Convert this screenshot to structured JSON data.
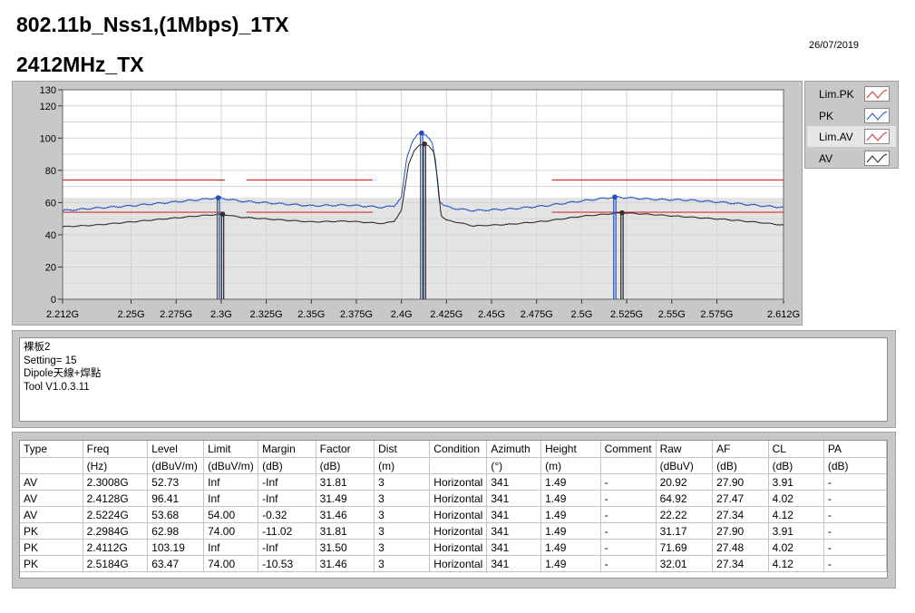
{
  "header": {
    "title_line1": "802.11b_Nss1,(1Mbps)_1TX",
    "title_line2": "2412MHz_TX",
    "date": "26/07/2019"
  },
  "legend": {
    "items": [
      {
        "label": "Lim.PK",
        "color": "#d0302f"
      },
      {
        "label": "PK",
        "color": "#1f4fbf"
      },
      {
        "label": "Lim.AV",
        "color": "#d0302f"
      },
      {
        "label": "AV",
        "color": "#222222"
      }
    ]
  },
  "notes": {
    "lines": [
      "裸板2",
      "Setting= 15",
      "Dipole天線+焊點",
      "Tool V1.0.3.11"
    ]
  },
  "table": {
    "columns": [
      "Type",
      "Freq",
      "Level",
      "Limit",
      "Margin",
      "Factor",
      "Dist",
      "Condition",
      "Azimuth",
      "Height",
      "Comment",
      "Raw",
      "AF",
      "CL",
      "PA"
    ],
    "units": [
      "",
      "(Hz)",
      "(dBuV/m)",
      "(dBuV/m)",
      "(dB)",
      "(dB)",
      "(m)",
      "",
      "(°)",
      "(m)",
      "",
      "(dBuV)",
      "(dB)",
      "(dB)",
      "(dB)"
    ],
    "rows": [
      [
        "AV",
        "2.3008G",
        "52.73",
        "Inf",
        "-Inf",
        "31.81",
        "3",
        "Horizontal",
        "341",
        "1.49",
        "-",
        "20.92",
        "27.90",
        "3.91",
        "-"
      ],
      [
        "AV",
        "2.4128G",
        "96.41",
        "Inf",
        "-Inf",
        "31.49",
        "3",
        "Horizontal",
        "341",
        "1.49",
        "-",
        "64.92",
        "27.47",
        "4.02",
        "-"
      ],
      [
        "AV",
        "2.5224G",
        "53.68",
        "54.00",
        "-0.32",
        "31.46",
        "3",
        "Horizontal",
        "341",
        "1.49",
        "-",
        "22.22",
        "27.34",
        "4.12",
        "-"
      ],
      [
        "PK",
        "2.2984G",
        "62.98",
        "74.00",
        "-11.02",
        "31.81",
        "3",
        "Horizontal",
        "341",
        "1.49",
        "-",
        "31.17",
        "27.90",
        "3.91",
        "-"
      ],
      [
        "PK",
        "2.4112G",
        "103.19",
        "Inf",
        "-Inf",
        "31.50",
        "3",
        "Horizontal",
        "341",
        "1.49",
        "-",
        "71.69",
        "27.48",
        "4.02",
        "-"
      ],
      [
        "PK",
        "2.5184G",
        "63.47",
        "74.00",
        "-10.53",
        "31.46",
        "3",
        "Horizontal",
        "341",
        "1.49",
        "-",
        "32.01",
        "27.34",
        "4.12",
        "-"
      ]
    ]
  },
  "chart_data": {
    "type": "line",
    "title": "",
    "xlabel": "",
    "ylabel": "",
    "xlim": [
      2.212,
      2.612
    ],
    "ylim": [
      0,
      130
    ],
    "x_ticks": [
      "2.212G",
      "2.25G",
      "2.275G",
      "2.3G",
      "2.325G",
      "2.35G",
      "2.375G",
      "2.4G",
      "2.425G",
      "2.45G",
      "2.475G",
      "2.5G",
      "2.525G",
      "2.55G",
      "2.575G",
      "2.612G"
    ],
    "x_tick_values": [
      2.212,
      2.25,
      2.275,
      2.3,
      2.325,
      2.35,
      2.375,
      2.4,
      2.425,
      2.45,
      2.475,
      2.5,
      2.525,
      2.55,
      2.575,
      2.612
    ],
    "y_ticks": [
      0,
      20,
      40,
      60,
      80,
      100,
      120,
      130
    ],
    "grid": true,
    "shaded_band_below": 63,
    "series": [
      {
        "name": "PK",
        "color": "#1f4fbf",
        "x": [
          2.212,
          2.23,
          2.25,
          2.27,
          2.29,
          2.2984,
          2.31,
          2.33,
          2.35,
          2.37,
          2.39,
          2.396,
          2.4,
          2.403,
          2.406,
          2.409,
          2.4112,
          2.414,
          2.417,
          2.419,
          2.421,
          2.424,
          2.428,
          2.44,
          2.46,
          2.48,
          2.5,
          2.5184,
          2.54,
          2.56,
          2.58,
          2.6,
          2.612
        ],
        "y": [
          55,
          56.5,
          58,
          60,
          62,
          62.98,
          61,
          59.5,
          58,
          58.5,
          57,
          58,
          63,
          88,
          98,
          102,
          103.19,
          102,
          97,
          85,
          61,
          58,
          56.5,
          55,
          56,
          58,
          61,
          63.47,
          62,
          61.5,
          60,
          58,
          57
        ]
      },
      {
        "name": "AV",
        "color": "#222222",
        "x": [
          2.212,
          2.23,
          2.25,
          2.27,
          2.29,
          2.3008,
          2.31,
          2.33,
          2.35,
          2.37,
          2.39,
          2.396,
          2.4,
          2.404,
          2.407,
          2.41,
          2.4128,
          2.415,
          2.418,
          2.42,
          2.422,
          2.425,
          2.43,
          2.44,
          2.46,
          2.48,
          2.5,
          2.5224,
          2.54,
          2.56,
          2.58,
          2.6,
          2.612
        ],
        "y": [
          45,
          46,
          48,
          50,
          52,
          52.73,
          51,
          49.5,
          48,
          48.5,
          47,
          48.5,
          55,
          84,
          92,
          95.5,
          96.41,
          95.5,
          91,
          75,
          52,
          49,
          48,
          45.5,
          46.5,
          48.5,
          51.5,
          53.68,
          52.5,
          51,
          49.5,
          47.5,
          46
        ]
      },
      {
        "name": "Lim.PK",
        "color": "#d0302f",
        "segments": [
          [
            2.212,
            2.302,
            74
          ],
          [
            2.314,
            2.384,
            74
          ],
          [
            2.4835,
            2.612,
            74
          ]
        ]
      },
      {
        "name": "Lim.AV",
        "color": "#d0302f",
        "segments": [
          [
            2.212,
            2.302,
            54
          ],
          [
            2.314,
            2.384,
            54
          ],
          [
            2.4835,
            2.612,
            54
          ]
        ]
      }
    ],
    "markers": [
      {
        "series": "PK",
        "x": 2.2984,
        "y": 62.98
      },
      {
        "series": "PK",
        "x": 2.4112,
        "y": 103.19
      },
      {
        "series": "PK",
        "x": 2.5184,
        "y": 63.47
      },
      {
        "series": "AV",
        "x": 2.3008,
        "y": 52.73
      },
      {
        "series": "AV",
        "x": 2.4128,
        "y": 96.41
      },
      {
        "series": "AV",
        "x": 2.5224,
        "y": 53.68
      }
    ],
    "legend": "right"
  }
}
